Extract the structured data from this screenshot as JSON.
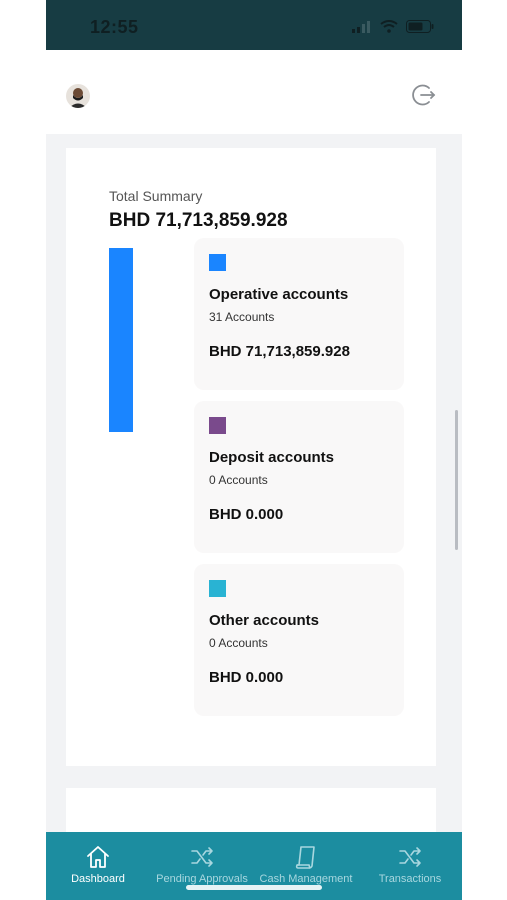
{
  "status_bar": {
    "time": "12:55"
  },
  "summary": {
    "label": "Total Summary",
    "total": "BHD 71,713,859.928",
    "bar_fraction": 1.0
  },
  "accounts": [
    {
      "name": "Operative accounts",
      "count": "31 Accounts",
      "amount": "BHD 71,713,859.928",
      "color": "#1a85ff"
    },
    {
      "name": "Deposit accounts",
      "count": "0 Accounts",
      "amount": "BHD 0.000",
      "color": "#7a4a8c"
    },
    {
      "name": "Other accounts",
      "count": "0 Accounts",
      "amount": "BHD 0.000",
      "color": "#29b3d3"
    }
  ],
  "tabs": [
    {
      "label": "Dashboard",
      "icon": "home-icon",
      "active": true
    },
    {
      "label": "Pending Approvals",
      "icon": "shuffle-icon",
      "active": false
    },
    {
      "label": "Cash Management",
      "icon": "document-icon",
      "active": false
    },
    {
      "label": "Transactions",
      "icon": "shuffle-icon",
      "active": false
    }
  ],
  "colors": {
    "status_bar": "#173c43",
    "tab_bar": "#1c8da0",
    "accent_blue": "#1a85ff",
    "deposit_purple": "#7a4a8c",
    "other_cyan": "#29b3d3"
  }
}
